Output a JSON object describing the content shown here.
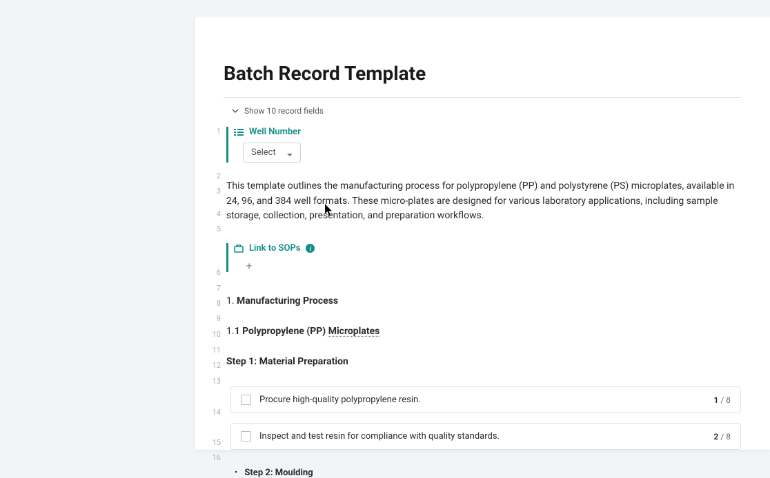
{
  "title": "Batch Record Template",
  "show_fields_label": "Show 10 record fields",
  "well_number": {
    "label": "Well Number",
    "select_text": "Select"
  },
  "description": "This template outlines the manufacturing process for polypropylene (PP) and polystyrene (PS) microplates, available in 24, 96, and 384 well formats. These micro-plates are designed for various laboratory applications, including sample storage, collection, presentation, and preparation workflows.",
  "link_sops": {
    "label": "Link to SOPs"
  },
  "sections": {
    "h1_num": "1. ",
    "h1_text": "Manufacturing Process",
    "h2_num": "1.",
    "h2_prefix": "1 Polypropylene (PP) ",
    "h2_underlined": "Microplates",
    "step1": "Step 1: Material Preparation",
    "step2_label": "Step 2: Moulding"
  },
  "checklist": [
    {
      "text": "Procure high-quality polypropylene resin.",
      "current": "1",
      "total": "8"
    },
    {
      "text": "Inspect and test resin for compliance with quality standards.",
      "current": "2",
      "total": "8"
    }
  ],
  "line_numbers": [
    "1",
    "2",
    "3",
    "4",
    "5",
    "6",
    "7",
    "8",
    "9",
    "10",
    "11",
    "12",
    "13",
    "14",
    "15",
    "16"
  ]
}
